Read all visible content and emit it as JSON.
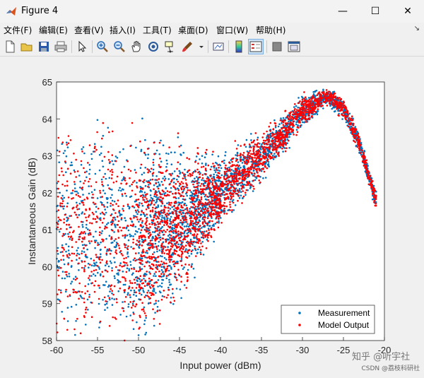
{
  "window": {
    "title": "Figure 4",
    "minimize_glyph": "—",
    "maximize_glyph": "☐",
    "close_glyph": "✕"
  },
  "menu": {
    "items": [
      "文件(F)",
      "编辑(E)",
      "查看(V)",
      "插入(I)",
      "工具(T)",
      "桌面(D)",
      "窗口(W)",
      "帮助(H)"
    ],
    "overflow_glyph": "↘"
  },
  "toolbar": {
    "icons": [
      "new-figure-icon",
      "open-folder-icon",
      "save-icon",
      "print-icon",
      "pointer-icon",
      "zoom-in-icon",
      "zoom-out-icon",
      "pan-hand-icon",
      "rotate-3d-icon",
      "data-cursor-icon",
      "brush-icon",
      "brush-dropdown-icon",
      "link-plot-icon",
      "colorbar-icon",
      "legend-icon",
      "hide-plot-tools-icon",
      "show-plot-tools-icon"
    ]
  },
  "colors": {
    "measurement": "#0072BD",
    "model": "#FF0000"
  },
  "chart_data": {
    "type": "scatter",
    "title": "",
    "xlabel": "Input power (dBm)",
    "ylabel": "Instantaneous Gain (dB)",
    "xlim": [
      -60,
      -20
    ],
    "ylim": [
      58,
      65
    ],
    "xticks": [
      "-60",
      "-55",
      "-50",
      "-45",
      "-40",
      "-35",
      "-30",
      "-25",
      "-20"
    ],
    "yticks": [
      "58",
      "59",
      "60",
      "61",
      "62",
      "63",
      "64",
      "65"
    ],
    "grid": false,
    "legend_position": "bottom-right",
    "series": [
      {
        "name": "Measurement",
        "color": "#0072BD",
        "trend": {
          "x": [
            -60,
            -55,
            -50,
            -45,
            -40,
            -35,
            -30,
            -27,
            -25,
            -23,
            -21
          ],
          "y": [
            61.0,
            60.8,
            60.7,
            61.2,
            62.0,
            63.0,
            64.2,
            64.6,
            64.3,
            63.3,
            61.8
          ]
        }
      },
      {
        "name": "Model Output",
        "color": "#FF0000",
        "trend": {
          "x": [
            -60,
            -55,
            -50,
            -45,
            -40,
            -35,
            -30,
            -27,
            -25,
            -23,
            -21
          ],
          "y": [
            61.0,
            60.8,
            60.7,
            61.2,
            62.0,
            63.0,
            64.2,
            64.6,
            64.3,
            63.3,
            61.8
          ]
        }
      }
    ]
  },
  "watermark": {
    "main": "知乎 @听宇社",
    "csdn": "CSDN @荔枝科研社"
  }
}
